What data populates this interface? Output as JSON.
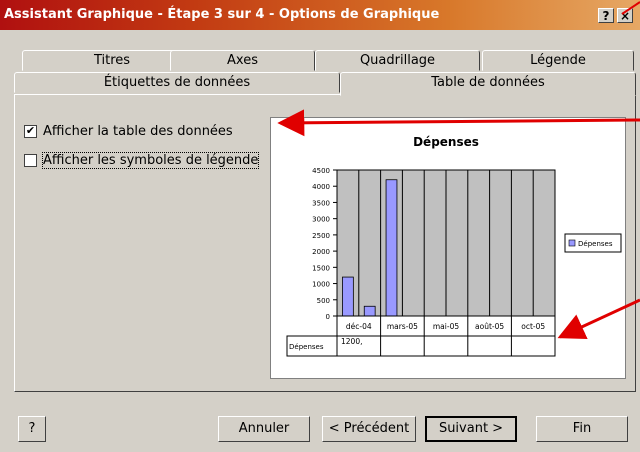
{
  "window": {
    "title": "Assistant Graphique - Étape 3 sur 4 - Options de Graphique",
    "help_btn": "?",
    "close_btn": "×"
  },
  "tabs_row1": [
    {
      "label": "Titres"
    },
    {
      "label": "Axes"
    },
    {
      "label": "Quadrillage"
    },
    {
      "label": "Légende"
    }
  ],
  "tabs_row2": [
    {
      "label": "Étiquettes de données"
    },
    {
      "label": "Table de données",
      "active": true
    }
  ],
  "options": {
    "show_table": {
      "label": "Afficher la table des données",
      "checked": true
    },
    "show_legend_keys": {
      "label": "Afficher les symboles de légende",
      "checked": false
    }
  },
  "chart_data": {
    "type": "bar",
    "title": "Dépenses",
    "categories": [
      "déc-04",
      "",
      "mars-05",
      "",
      "mai-05",
      "",
      "août-05",
      "",
      "oct-05",
      ""
    ],
    "series": [
      {
        "name": "Dépenses",
        "values": [
          1200,
          300,
          4200,
          0,
          0,
          0,
          0,
          0,
          0,
          0
        ]
      }
    ],
    "ylim": [
      0,
      4500
    ],
    "yticks": [
      0,
      500,
      1000,
      1500,
      2000,
      2500,
      3000,
      3500,
      4000,
      4500
    ],
    "grid": true,
    "legend": "right",
    "legend_label": "Dépenses",
    "table": {
      "row_label": "Dépenses",
      "cells": [
        "1200,",
        "",
        "",
        "",
        ""
      ]
    },
    "colors": {
      "plot_bg": "#c0c0c0",
      "bar": "#9999ff"
    }
  },
  "buttons": {
    "help": "?",
    "cancel": "Annuler",
    "prev": "< Précédent",
    "next": "Suivant >",
    "finish": "Fin"
  }
}
